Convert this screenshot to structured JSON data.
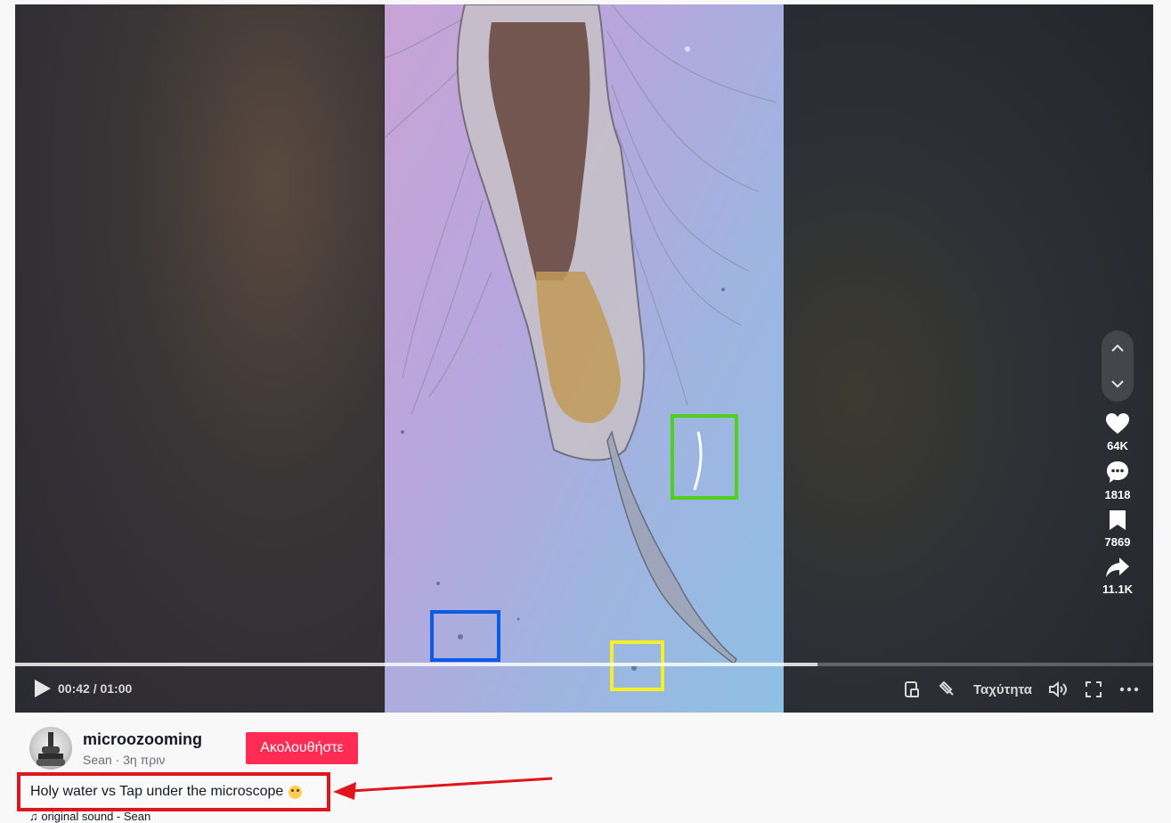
{
  "video": {
    "time_display": "00:42 / 01:00",
    "progress": 0.705,
    "speed_label": "Ταχύτητα"
  },
  "actions": {
    "likes": "64K",
    "comments": "1818",
    "saves": "7869",
    "shares": "11.1K"
  },
  "author": {
    "username": "microozooming",
    "subline": "Sean · 3η πριν",
    "follow_label": "Ακολουθήστε"
  },
  "caption": {
    "text": "Holy water vs Tap under the microscope"
  },
  "sound": {
    "text": "♫ original sound - Sean"
  },
  "annotations": {
    "colors": [
      "#0a5ce6",
      "#f5ee2a",
      "#4fd11c",
      "#e0161c"
    ]
  },
  "icons": [
    "play-icon",
    "chevron-up-icon",
    "chevron-down-icon",
    "heart-icon",
    "comment-icon",
    "bookmark-icon",
    "share-icon",
    "miniplayer-icon",
    "floating-icon",
    "volume-icon",
    "fullscreen-icon",
    "more-icon",
    "arrow-annotation"
  ]
}
